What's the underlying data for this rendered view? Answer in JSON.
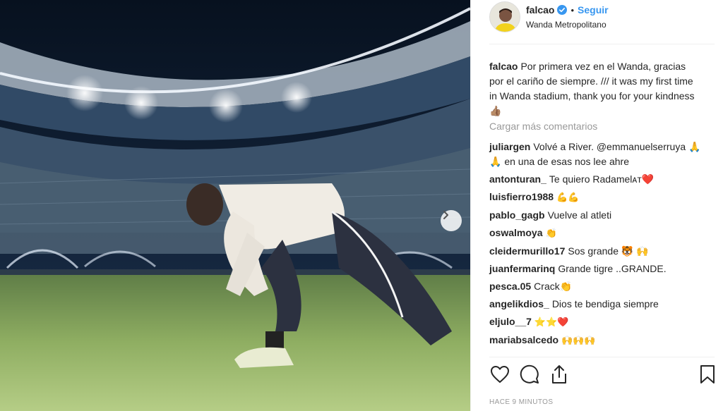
{
  "post": {
    "username": "falcao",
    "verified_icon": "verified-badge-icon",
    "separator": "•",
    "follow_label": "Seguir",
    "location": "Wanda Metropolitano",
    "caption_user": "falcao",
    "caption_text": "Por primera vez en el Wanda, gracias por el cariño de siempre. /// it was my first time in Wanda stadium, thank you for your kindness 👍🏽",
    "load_more": "Cargar más comentarios",
    "timestamp": "HACE 9 MINUTOS",
    "accent_color": "#3897f0"
  },
  "comments": [
    {
      "user": "juliargen",
      "text": "Volvé a River. @emmanuelserruya 🙏🙏 en una de esas nos lee ahre"
    },
    {
      "user": "antonturan_",
      "text": "Te quiero Radamelᴀᴛ❤️"
    },
    {
      "user": "luisfierro1988",
      "text": "💪💪"
    },
    {
      "user": "pablo_gagb",
      "text": "Vuelve al atleti"
    },
    {
      "user": "oswalmoya",
      "text": "👏"
    },
    {
      "user": "cleidermurillo17",
      "text": "Sos grande 🐯 🙌"
    },
    {
      "user": "juanfermarinq",
      "text": "Grande tigre ..GRANDE."
    },
    {
      "user": "pesca.05",
      "text": "Crack👏"
    },
    {
      "user": "angelikdios_",
      "text": "Dios te bendiga siempre"
    },
    {
      "user": "eljulo__7",
      "text": "⭐⭐❤️"
    },
    {
      "user": "mariabsalcedo",
      "text": "🙌🙌🙌"
    }
  ],
  "actions": {
    "like_icon": "heart-icon",
    "comment_icon": "comment-icon",
    "share_icon": "share-icon",
    "save_icon": "bookmark-icon"
  },
  "photo": {
    "next_icon": "chevron-right-icon"
  }
}
